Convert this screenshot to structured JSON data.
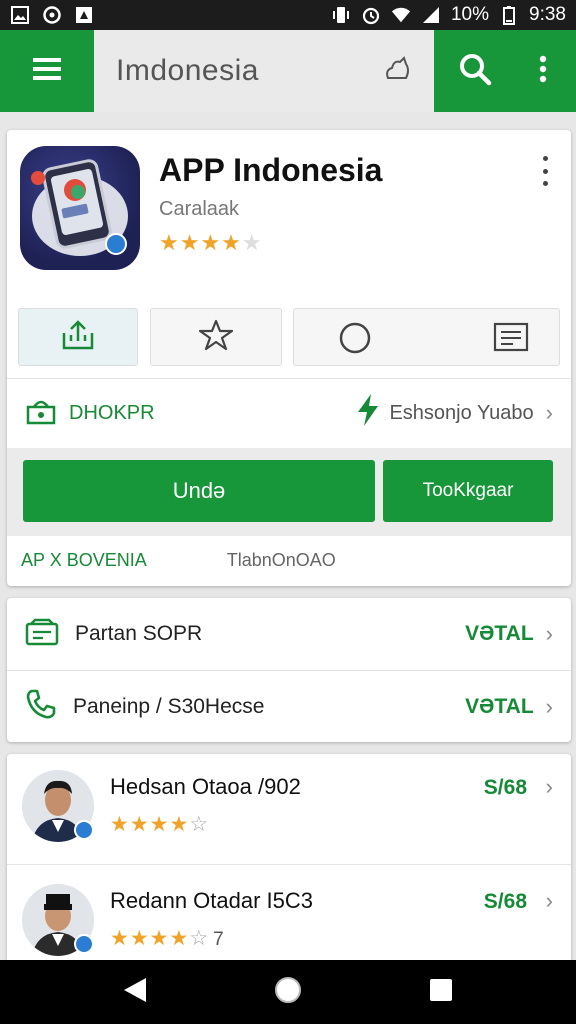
{
  "status_bar": {
    "battery": "10%",
    "time": "9:38"
  },
  "app_bar": {
    "search_text": "Imdonesia"
  },
  "app": {
    "title": "APP Indonesia",
    "subtitle": "Caralaak",
    "rating_stars": 4
  },
  "developer": {
    "name": "DHOKPR",
    "action": "Eshsonjo Yuabo"
  },
  "buttons": {
    "install": "Undə",
    "other": "TooKkgaar"
  },
  "footer": {
    "left": "AP X BOVENIA",
    "right": "TlabnOnOAO"
  },
  "info_rows": [
    {
      "label": "Partan SOPR",
      "value": "VƏTAL"
    },
    {
      "label": "Paneinp / S30Hecse",
      "value": "VƏTAL"
    }
  ],
  "reviews": [
    {
      "name": "Hedsan Otaoa /902",
      "rating": 4,
      "count": "",
      "value": "S/68"
    },
    {
      "name": "Redann Otadar I5C3",
      "rating": 4,
      "count": "7",
      "value": "S/68"
    }
  ],
  "colors": {
    "brand_green": "#17963a",
    "star": "#f0a229"
  }
}
